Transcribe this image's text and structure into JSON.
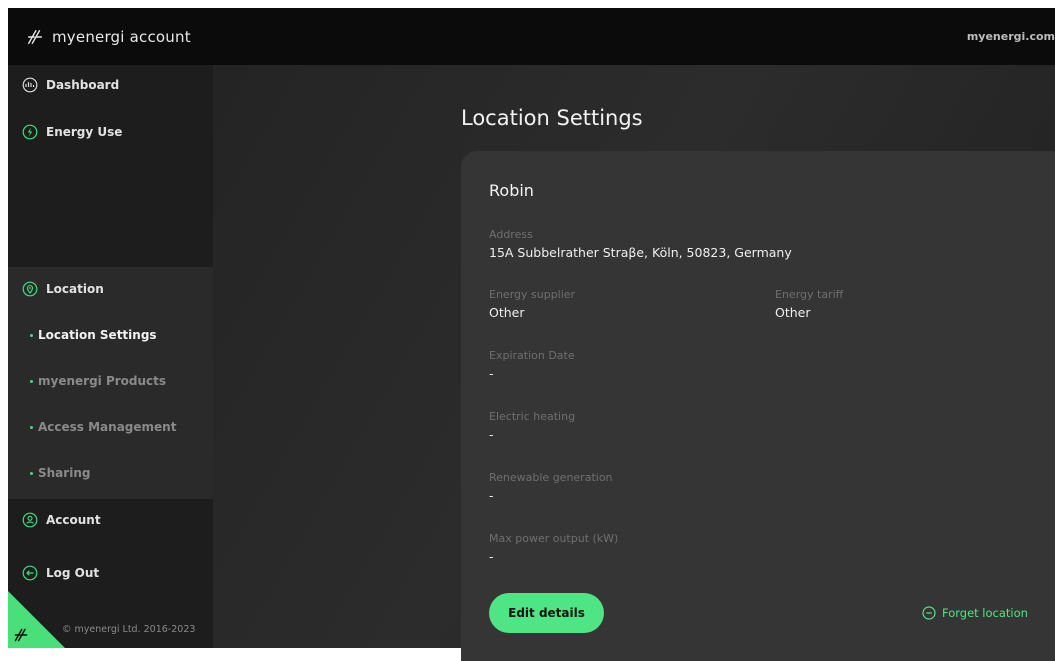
{
  "header": {
    "brand": "myenergi account",
    "site_link": "myenergi.com"
  },
  "sidebar": {
    "items": [
      {
        "label": "Dashboard",
        "icon": "dashboard-icon"
      },
      {
        "label": "Energy Use",
        "icon": "lightning-icon"
      },
      {
        "label": "Location",
        "icon": "location-pin-icon"
      },
      {
        "label": "Account",
        "icon": "user-icon"
      },
      {
        "label": "Log Out",
        "icon": "logout-icon"
      }
    ],
    "location_sub": [
      {
        "label": "Location Settings",
        "active": true
      },
      {
        "label": "myenergi Products",
        "active": false
      },
      {
        "label": "Access Management",
        "active": false
      },
      {
        "label": "Sharing",
        "active": false
      }
    ],
    "copyright": "© myenergi Ltd. 2016-2023"
  },
  "main": {
    "title": "Location Settings",
    "card": {
      "name": "Robin",
      "address_label": "Address",
      "address_value": "15A Subbelrather Straβe, Köln, 50823, Germany",
      "supplier_label": "Energy supplier",
      "supplier_value": "Other",
      "tariff_label": "Energy tariff",
      "tariff_value": "Other",
      "expiration_label": "Expiration Date",
      "expiration_value": "-",
      "heating_label": "Electric heating",
      "heating_value": "-",
      "renewable_label": "Renewable generation",
      "renewable_value": "-",
      "max_power_label": "Max power output (kW)",
      "max_power_value": "-",
      "edit_label": "Edit details",
      "forget_label": "Forget location"
    }
  },
  "colors": {
    "accent": "#4fe584",
    "topbar": "#0b0b0b",
    "sidebar": "#1d1d1d",
    "card": "#353535"
  }
}
